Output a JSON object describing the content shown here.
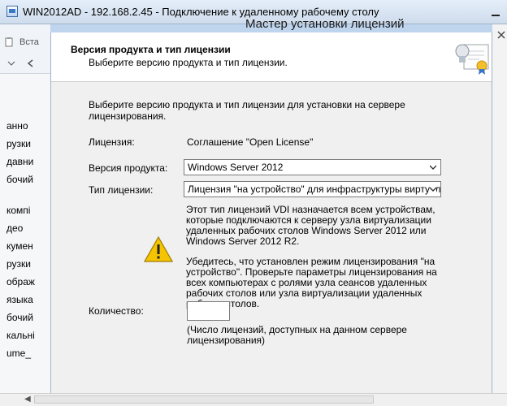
{
  "rdp": {
    "title": "WIN2012AD - 192.168.2.45 - Подключение к удаленному рабочему столу"
  },
  "background_window": {
    "toolbar_partial": "Вста",
    "list_items": [
      "анно",
      "рузки",
      "давни",
      "бочий",
      "компі",
      "део",
      "кумен",
      "рузки",
      "ображ",
      "языка",
      "бочий",
      "кальні",
      "ume_"
    ]
  },
  "dialog": {
    "window_title_partial": "Мастер установки лицензий",
    "header_title": "Версия продукта и тип лицензии",
    "header_subtitle": "Выберите версию продукта и тип лицензии.",
    "intro": "Выберите версию продукта и тип лицензии для установки на сервере лицензирования.",
    "license_label": "Лицензия:",
    "license_value": "Соглашение \"Open License\"",
    "version_label": "Версия продукта:",
    "version_value": "Windows Server 2012",
    "type_label": "Тип лицензии:",
    "type_value": "Лицензия \"на устройство\" для инфраструктуры виртуальных",
    "info_text_1": "Этот тип лицензий VDI назначается всем устройствам, которые подключаются к серверу узла виртуализации удаленных рабочих столов Windows Server 2012 или Windows Server 2012 R2.",
    "info_text_2": "Убедитесь, что установлен режим лицензирования \"на устройство\". Проверьте параметры лицензирования на всех компьютерах с ролями узла сеансов удаленных рабочих столов или узла виртуализации удаленных рабочих столов.",
    "quantity_label": "Количество:",
    "quantity_value": "",
    "quantity_note": "(Число лицензий, доступных на данном сервере лицензирования)"
  },
  "colors": {
    "accent": "#bfd5ee",
    "dialog_bg": "#f0f0f0",
    "warning": "#f5c400"
  }
}
